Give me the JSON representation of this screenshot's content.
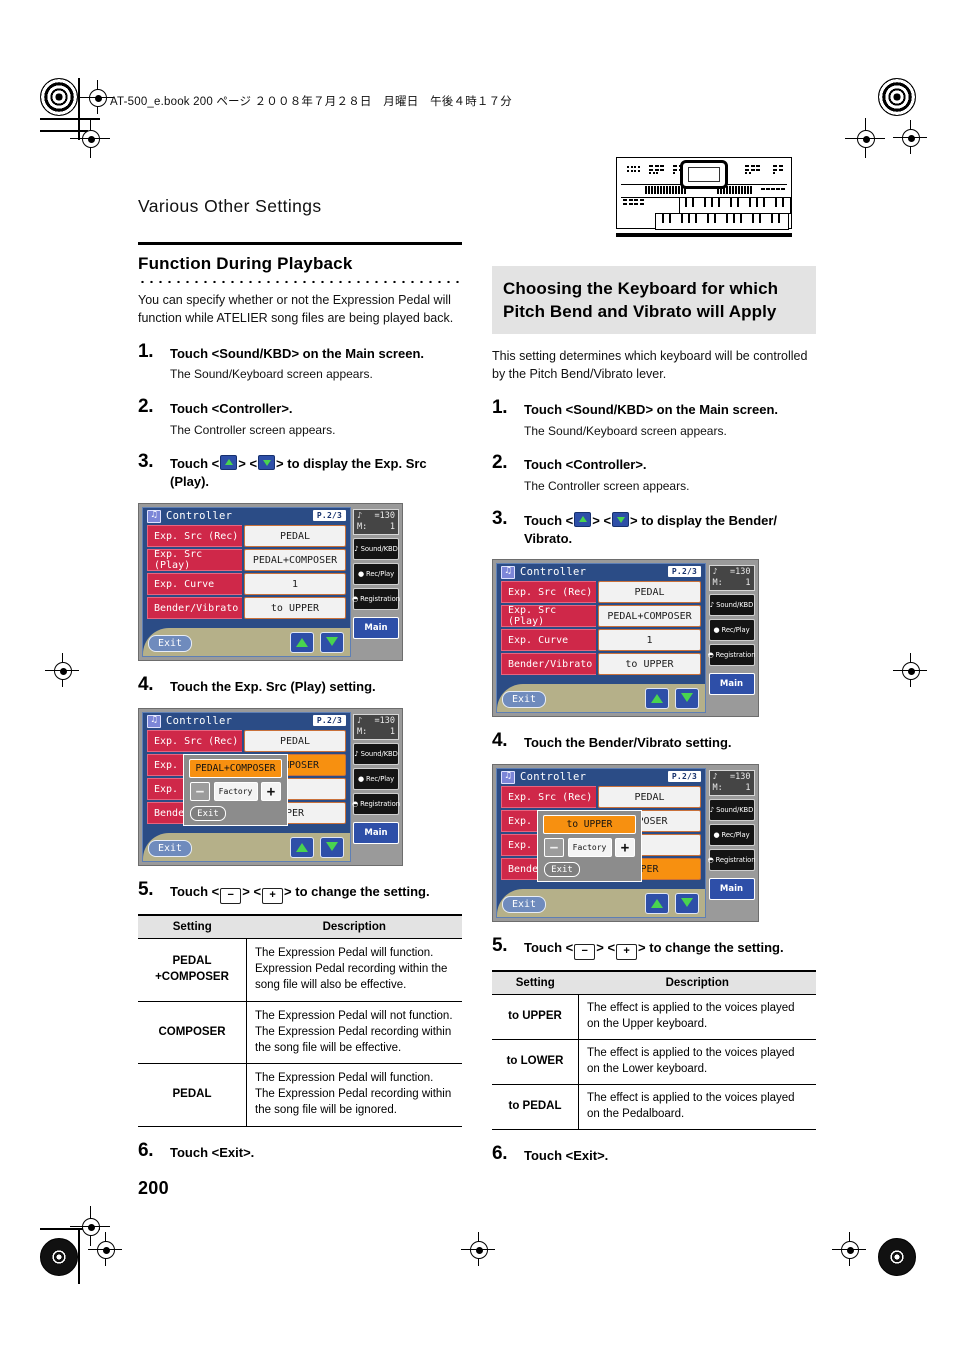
{
  "slug": "AT-500_e.book  200 ページ  ２００８年７月２８日　月曜日　午後４時１７分",
  "running_head": "Various Other Settings",
  "page_number": "200",
  "colors": {
    "lcd_bezel": "#9a9a9a",
    "lcd_blue": "#2b4c86",
    "label_red": "#cf2849",
    "highlight_orange": "#f79010",
    "button_blue": "#2e4fa8",
    "arrow_green": "#49d44f",
    "footer_khaki": "#b5b089",
    "heading_grey": "#e3e3e3"
  },
  "left": {
    "heading": "Function During Playback",
    "intro": "You can specify whether or not the Expression Pedal will function while ATELIER song files are being played back.",
    "steps": [
      {
        "num": "1.",
        "title": "Touch <Sound/KBD> on the Main screen.",
        "body": "The Sound/Keyboard screen appears."
      },
      {
        "num": "2.",
        "title": "Touch <Controller>.",
        "body": "The Controller screen appears."
      },
      {
        "num": "3.",
        "title_pre": "Touch <",
        "title_mid": "> <",
        "title_post": "> to display the Exp. Src (Play)."
      },
      {
        "num": "4.",
        "title": "Touch the Exp. Src (Play) setting."
      },
      {
        "num": "5.",
        "title_pre": "Touch <",
        "minus": "−",
        "title_mid": "> <",
        "plus": "+",
        "title_post": "> to change the setting."
      },
      {
        "num": "6.",
        "title": "Touch <Exit>."
      }
    ],
    "lcd1": {
      "title": "Controller",
      "page_badge": "P.2/3",
      "note_icon": "music-note-icon",
      "rows": [
        {
          "label": "Exp. Src (Rec)",
          "value": "PEDAL",
          "highlight": false
        },
        {
          "label": "Exp. Src (Play)",
          "value": "PEDAL+COMPOSER",
          "highlight": false
        },
        {
          "label": "Exp. Curve",
          "value": "1",
          "highlight": false
        },
        {
          "label": "Bender/Vibrato",
          "value": "to UPPER",
          "highlight": false
        }
      ],
      "exit": "Exit",
      "side": {
        "tempo_label": "♪",
        "tempo_value": "=130",
        "measure_label": "M:",
        "measure_value": "1",
        "buttons": [
          "Sound/KBD",
          "Rec/Play",
          "Registration"
        ],
        "main": "Main"
      }
    },
    "lcd2": {
      "title": "Controller",
      "page_badge": "P.2/3",
      "rows": [
        {
          "label": "Exp. Src (Rec)",
          "value": "PEDAL",
          "highlight": false
        },
        {
          "label": "Exp. Sr",
          "value": "COMPOSER",
          "highlight": true
        },
        {
          "label": "Exp. Cu",
          "value": "",
          "highlight": false
        },
        {
          "label": "Bender/",
          "value": "PER",
          "highlight": false
        }
      ],
      "popup": {
        "value": "PEDAL+COMPOSER",
        "minus": "−",
        "factory": "Factory",
        "plus": "+",
        "exit": "Exit"
      },
      "exit": "Exit"
    },
    "table": {
      "headers": [
        "Setting",
        "Description"
      ],
      "rows": [
        {
          "setting": "PEDAL +COMPOSER",
          "setting_line1": "PEDAL",
          "setting_line2": "+COMPOSER",
          "description": "The Expression Pedal will function. Expression Pedal recording within the song file will also be effective."
        },
        {
          "setting": "COMPOSER",
          "setting_line1": "COMPOSER",
          "setting_line2": "",
          "description": "The Expression Pedal will not function. The Expression Pedal recording within the song file will be effective."
        },
        {
          "setting": "PEDAL",
          "setting_line1": "PEDAL",
          "setting_line2": "",
          "description": "The Expression Pedal will function. The Expression Pedal recording within the song file will be ignored."
        }
      ]
    }
  },
  "right": {
    "heading": "Choosing the Keyboard for which Pitch Bend and Vibrato will Apply",
    "intro": "This setting determines which keyboard will be controlled by the Pitch Bend/Vibrato lever.",
    "steps": [
      {
        "num": "1.",
        "title": "Touch <Sound/KBD> on the Main screen.",
        "body": "The Sound/Keyboard screen appears."
      },
      {
        "num": "2.",
        "title": "Touch <Controller>.",
        "body": "The Controller screen appears."
      },
      {
        "num": "3.",
        "title_pre": "Touch <",
        "title_mid": "> <",
        "title_post": "> to display the Bender/ Vibrato."
      },
      {
        "num": "4.",
        "title": "Touch the Bender/Vibrato setting."
      },
      {
        "num": "5.",
        "title_pre": "Touch <",
        "minus": "−",
        "title_mid": "> <",
        "plus": "+",
        "title_post": "> to change the setting."
      },
      {
        "num": "6.",
        "title": "Touch <Exit>."
      }
    ],
    "lcd1": {
      "title": "Controller",
      "page_badge": "P.2/3",
      "rows": [
        {
          "label": "Exp. Src (Rec)",
          "value": "PEDAL",
          "highlight": false
        },
        {
          "label": "Exp. Src (Play)",
          "value": "PEDAL+COMPOSER",
          "highlight": false
        },
        {
          "label": "Exp. Curve",
          "value": "1",
          "highlight": false
        },
        {
          "label": "Bender/Vibrato",
          "value": "to UPPER",
          "highlight": false
        }
      ],
      "exit": "Exit",
      "side": {
        "tempo_label": "♪",
        "tempo_value": "=130",
        "measure_label": "M:",
        "measure_value": "1",
        "buttons": [
          "Sound/KBD",
          "Rec/Play",
          "Registration"
        ],
        "main": "Main"
      }
    },
    "lcd2": {
      "title": "Controller",
      "page_badge": "P.2/3",
      "rows": [
        {
          "label": "Exp. Src (Rec)",
          "value": "PEDAL",
          "highlight": false
        },
        {
          "label": "Exp. Sr",
          "value": "NPOSER",
          "highlight": false
        },
        {
          "label": "Exp. Cu",
          "value": "",
          "highlight": false
        },
        {
          "label": "Bender/",
          "value": "PER",
          "highlight": true
        }
      ],
      "popup": {
        "value": "to UPPER",
        "minus": "−",
        "factory": "Factory",
        "plus": "+",
        "exit": "Exit"
      },
      "exit": "Exit"
    },
    "table": {
      "headers": [
        "Setting",
        "Description"
      ],
      "rows": [
        {
          "setting": "to UPPER",
          "description": "The effect is applied to the voices played on the Upper keyboard."
        },
        {
          "setting": "to LOWER",
          "description": "The effect is applied to the voices played on the Lower keyboard."
        },
        {
          "setting": "to PEDAL",
          "description": "The effect is applied to the voices played on the Pedalboard."
        }
      ]
    }
  }
}
